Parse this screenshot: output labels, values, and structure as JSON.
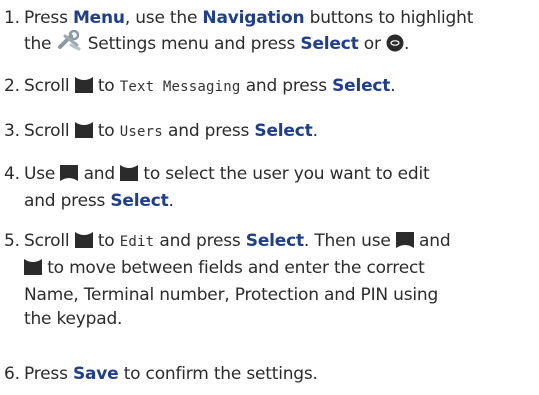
{
  "steps": [
    {
      "n": "1.",
      "t1": "Press ",
      "k1": "Menu",
      "t2": ", use the ",
      "k2": "Navigation",
      "t3": " buttons to highlight",
      "t4": "the ",
      "t5": " Settings menu and press ",
      "k3": "Select",
      "t6": " or ",
      "t7": "."
    },
    {
      "n": "2.",
      "t1": "Scroll ",
      "t2": " to ",
      "lcd": "Text Messaging",
      "t3": " and press ",
      "k": "Select",
      "t4": "."
    },
    {
      "n": "3.",
      "t1": "Scroll ",
      "t2": " to ",
      "lcd": "Users",
      "t3": " and press ",
      "k": "Select",
      "t4": "."
    },
    {
      "n": "4.",
      "t1": "Use ",
      "t2": " and ",
      "t3": " to select the user you want to edit",
      "t4": "and press ",
      "k": "Select",
      "t5": "."
    },
    {
      "n": "5.",
      "t1": "Scroll ",
      "t2": " to ",
      "lcd": "Edit",
      "t3": " and press ",
      "k": "Select",
      "t4": ". Then use ",
      "t5": " and",
      "t6": " to move between fields and enter the correct",
      "t7": "Name, Terminal number, Protection and PIN using",
      "t8": "the keypad."
    },
    {
      "n": "6.",
      "t1": "Press ",
      "k": "Save",
      "t2": " to confirm the settings."
    }
  ],
  "icons": {
    "settings": "settings-icon",
    "ok": "ok-button-icon",
    "scroll_down": "scroll-down-icon",
    "scroll_up": "scroll-up-icon"
  },
  "colors": {
    "keyword": "#1f3f8a",
    "text": "#2b2b2b"
  }
}
